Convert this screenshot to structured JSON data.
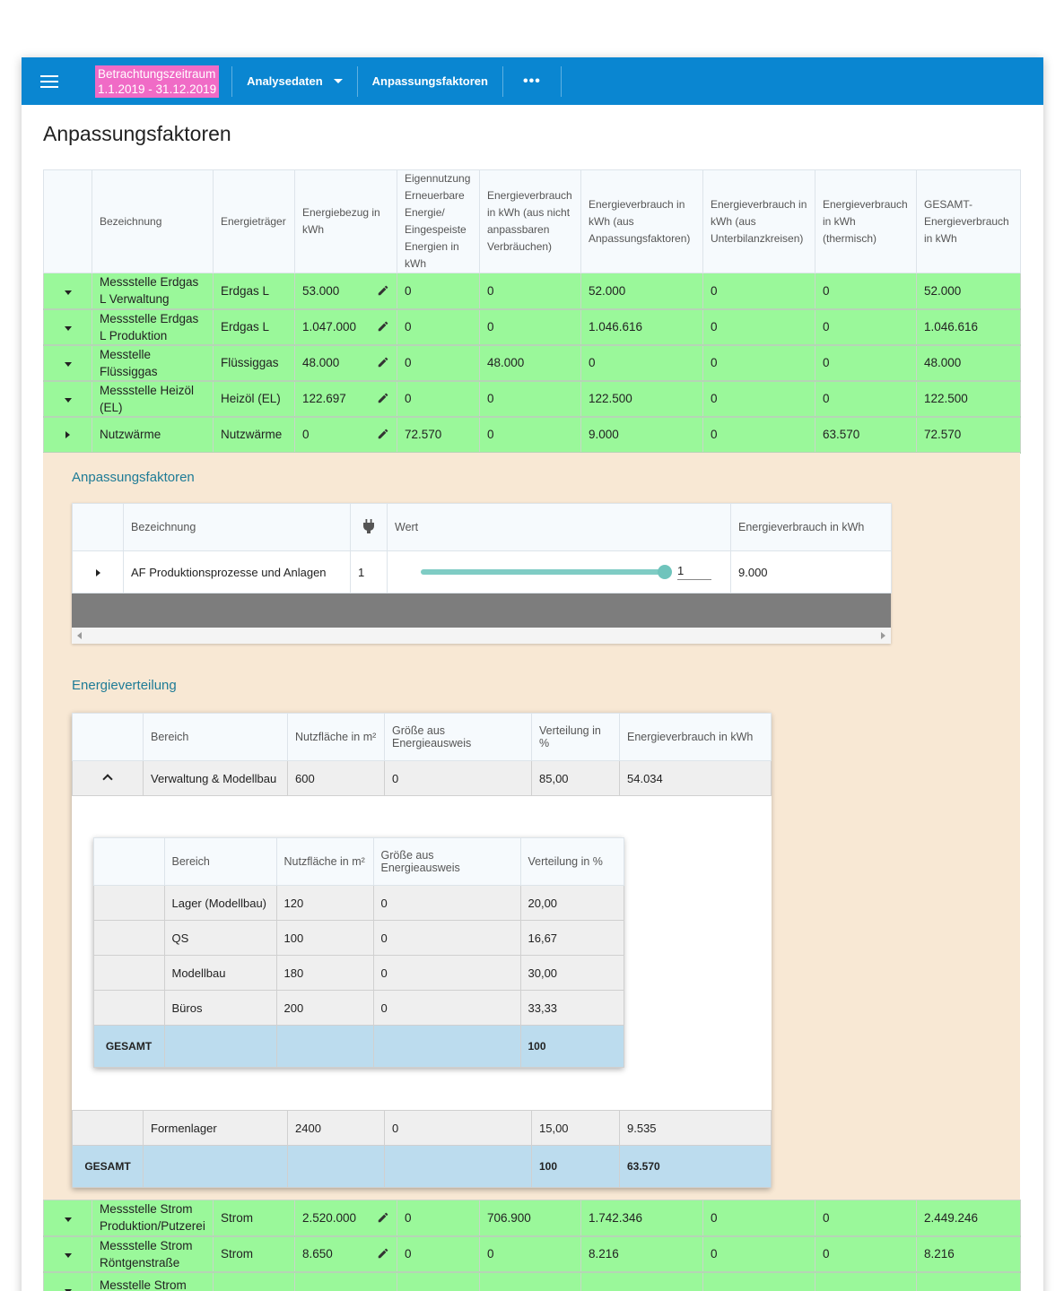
{
  "topbar": {
    "period_line1": "Betrachtungszeitraum",
    "period_line2": "1.1.2019 - 31.12.2019",
    "analysedaten": "Analysedaten",
    "anpassungsfaktoren": "Anpassungsfaktoren",
    "more": "•••"
  },
  "page": {
    "title": "Anpassungsfaktoren"
  },
  "main": {
    "headers": [
      "Bezeichnung",
      "Energieträger",
      "Energiebezug in kWh",
      "Eigennutzung Erneuerbare Energie/ Eingespeiste Energien in kWh",
      "Energieverbrauch in kWh (aus nicht anpassbaren Verbräuchen)",
      "Energieverbrauch in kWh (aus Anpassungsfaktoren)",
      "Energieverbrauch in kWh (aus Unterbilanzkreisen)",
      "Energieverbrauch in kWh (thermisch)",
      "GESAMT-Energieverbrauch in kWh"
    ],
    "rows": [
      {
        "name": "Messstelle Erdgas L Verwaltung",
        "carrier": "Erdgas L",
        "bezug": "53.000",
        "eigen": "0",
        "nicht": "0",
        "af": "52.000",
        "unter": "0",
        "therm": "0",
        "gesamt": "52.000"
      },
      {
        "name": "Messstelle Erdgas L Produktion",
        "carrier": "Erdgas L",
        "bezug": "1.047.000",
        "eigen": "0",
        "nicht": "0",
        "af": "1.046.616",
        "unter": "0",
        "therm": "0",
        "gesamt": "1.046.616"
      },
      {
        "name": "Messtelle Flüssiggas",
        "carrier": "Flüssiggas",
        "bezug": "48.000",
        "eigen": "0",
        "nicht": "48.000",
        "af": "0",
        "unter": "0",
        "therm": "0",
        "gesamt": "48.000"
      },
      {
        "name": "Messstelle Heizöl (EL)",
        "carrier": "Heizöl (EL)",
        "bezug": "122.697",
        "eigen": "0",
        "nicht": "0",
        "af": "122.500",
        "unter": "0",
        "therm": "0",
        "gesamt": "122.500"
      },
      {
        "name": "Nutzwärme",
        "carrier": "Nutzwärme",
        "bezug": "0",
        "eigen": "72.570",
        "nicht": "0",
        "af": "9.000",
        "unter": "0",
        "therm": "63.570",
        "gesamt": "72.570"
      }
    ],
    "rows_after": [
      {
        "name": "Messstelle Strom Produktion/Putzerei",
        "carrier": "Strom",
        "bezug": "2.520.000",
        "eigen": "0",
        "nicht": "706.900",
        "af": "1.742.346",
        "unter": "0",
        "therm": "0",
        "gesamt": "2.449.246"
      },
      {
        "name": "Messstelle Strom Röntgenstraße",
        "carrier": "Strom",
        "bezug": "8.650",
        "eigen": "0",
        "nicht": "0",
        "af": "8.216",
        "unter": "0",
        "therm": "0",
        "gesamt": "8.216"
      },
      {
        "name": "Messtelle Strom",
        "carrier": "",
        "bezug": "",
        "eigen": "",
        "nicht": "",
        "af": "",
        "unter": "",
        "therm": "",
        "gesamt": ""
      }
    ]
  },
  "af_section": {
    "title": "Anpassungsfaktoren",
    "headers": {
      "bezeichnung": "Bezeichnung",
      "wert": "Wert",
      "verbrauch": "Energieverbrauch in kWh"
    },
    "row": {
      "name": "AF Produktionsprozesse und Anlagen",
      "count": "1",
      "value": "1",
      "verbrauch": "9.000"
    },
    "slider_level": 1.0
  },
  "ev_section": {
    "title": "Energieverteilung",
    "headers": [
      "Bereich",
      "Nutzfläche in m²",
      "Größe aus Energieausweis",
      "Verteilung in %",
      "Energieverbrauch in kWh"
    ],
    "rows": [
      {
        "bereich": "Verwaltung & Modellbau",
        "flaeche": "600",
        "groesse": "0",
        "verteilung": "85,00",
        "verbrauch": "54.034"
      },
      {
        "bereich": "Formenlager",
        "flaeche": "2400",
        "groesse": "0",
        "verteilung": "15,00",
        "verbrauch": "9.535"
      }
    ],
    "total": {
      "label": "GESAMT",
      "verteilung": "100",
      "verbrauch": "63.570"
    },
    "sub": {
      "headers": [
        "Bereich",
        "Nutzfläche in m²",
        "Größe aus Energieausweis",
        "Verteilung in %"
      ],
      "rows": [
        {
          "bereich": "Lager (Modellbau)",
          "flaeche": "120",
          "groesse": "0",
          "verteilung": "20,00"
        },
        {
          "bereich": "QS",
          "flaeche": "100",
          "groesse": "0",
          "verteilung": "16,67"
        },
        {
          "bereich": "Modellbau",
          "flaeche": "180",
          "groesse": "0",
          "verteilung": "30,00"
        },
        {
          "bereich": "Büros",
          "flaeche": "200",
          "groesse": "0",
          "verteilung": "33,33"
        }
      ],
      "total": {
        "label": "GESAMT",
        "verteilung": "100"
      }
    }
  },
  "colors": {
    "topbar": "#0a86d1",
    "period_badge": "#f06bc6",
    "row_green": "#9af89a",
    "detail_bg": "#f8e8d4",
    "total_blue": "#bcdcee",
    "section_title": "#1e7b96",
    "slider": "#7fccc4"
  },
  "icons": [
    "menu-icon",
    "caret-down-icon",
    "more-icon",
    "expand-icon",
    "collapse-icon",
    "edit-icon",
    "plug-icon",
    "chevron-up-icon",
    "scroll-left-icon",
    "scroll-right-icon"
  ]
}
